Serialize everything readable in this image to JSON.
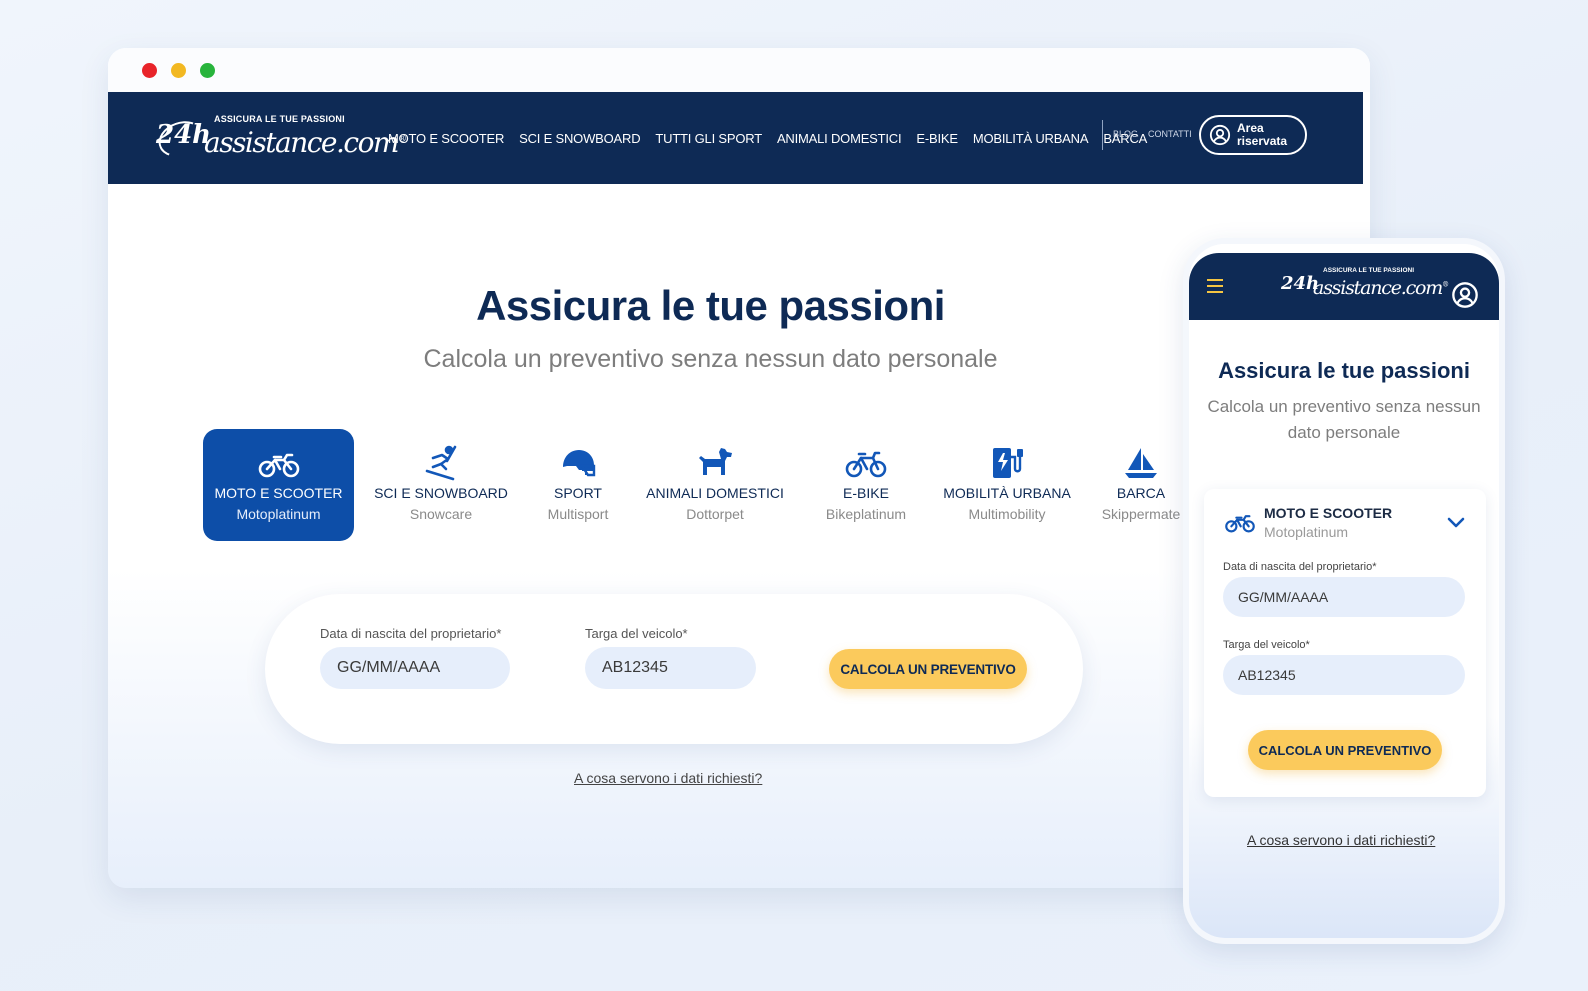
{
  "desktop": {
    "brand": {
      "tagline": "ASSICURA LE TUE PASSIONI",
      "logo_num": "24h",
      "logo_word": "assistance.com",
      "logo_mark": "®"
    },
    "nav": {
      "links": [
        "MOTO E SCOOTER",
        "SCI E SNOWBOARD",
        "TUTTI GLI SPORT",
        "ANIMALI DOMESTICI",
        "E-BIKE",
        "MOBILITÀ URBANA",
        "BARCA"
      ],
      "blog": "BLOG",
      "contacts": "CONTATTI",
      "area_label": "Area riservata"
    },
    "hero": {
      "title": "Assicura le tue passioni",
      "subtitle": "Calcola un preventivo senza nessun dato personale"
    },
    "categories": [
      {
        "title": "MOTO E SCOOTER",
        "product": "Motoplatinum",
        "icon": "motorbike-icon",
        "active": true
      },
      {
        "title": "SCI E SNOWBOARD",
        "product": "Snowcare",
        "icon": "skier-icon",
        "active": false
      },
      {
        "title": "SPORT",
        "product": "Multisport",
        "icon": "helmet-icon",
        "active": false
      },
      {
        "title": "ANIMALI DOMESTICI",
        "product": "Dottorpet",
        "icon": "dog-icon",
        "active": false
      },
      {
        "title": "E-BIKE",
        "product": "Bikeplatinum",
        "icon": "bicycle-icon",
        "active": false
      },
      {
        "title": "MOBILITÀ URBANA",
        "product": "Multimobility",
        "icon": "charging-station-icon",
        "active": false
      },
      {
        "title": "BARCA",
        "product": "Skippermate",
        "icon": "sailboat-icon",
        "active": false
      }
    ],
    "form": {
      "birth_label": "Data di nascita del proprietario*",
      "birth_placeholder": "GG/MM/AAAA",
      "plate_label": "Targa del veicolo*",
      "plate_placeholder": "AB12345",
      "cta": "CALCOLA UN PREVENTIVO"
    },
    "why_link": "A cosa servono i dati richiesti?"
  },
  "mobile": {
    "brand": {
      "tagline": "ASSICURA LE TUE PASSIONI",
      "logo_num": "24h",
      "logo_word": "assistance.com",
      "logo_mark": "®"
    },
    "title": "Assicura le tue passioni",
    "subtitle": "Calcola un preventivo senza nessun dato personale",
    "selected_category": {
      "title": "MOTO E SCOOTER",
      "product": "Motoplatinum"
    },
    "form": {
      "birth_label": "Data di nascita del proprietario*",
      "birth_placeholder": "GG/MM/AAAA",
      "plate_label": "Targa del veicolo*",
      "plate_placeholder": "AB12345",
      "cta": "CALCOLA UN PREVENTIVO"
    },
    "why_link": "A cosa servono i dati richiesti?"
  },
  "colors": {
    "navy": "#0e2a55",
    "active_blue": "#0d4ea8",
    "cta_yellow": "#fbca5c",
    "input_bg": "#e6eefb",
    "icon_blue": "#1257b8"
  }
}
